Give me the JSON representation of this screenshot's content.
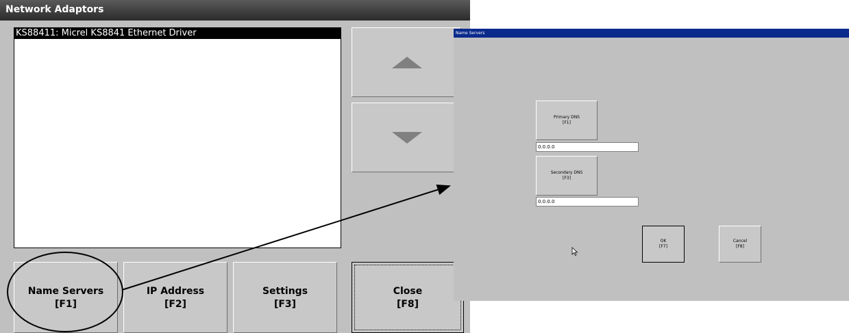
{
  "network_adaptors": {
    "title": "Network Adaptors",
    "list": [
      "KS88411: Micrel KS8841 Ethernet Driver"
    ],
    "buttons": [
      {
        "label": "Name Servers",
        "key": "[F1]"
      },
      {
        "label": "IP Address",
        "key": "[F2]"
      },
      {
        "label": "Settings",
        "key": "[F3]"
      },
      {
        "label": "Close",
        "key": "[F8]"
      }
    ],
    "scroll_up_icon": "triangle-up",
    "scroll_down_icon": "triangle-down"
  },
  "name_servers": {
    "title": "Name Servers",
    "primary": {
      "label": "Primary DNS",
      "key": "[F1]",
      "value": "0.0.0.0"
    },
    "secondary": {
      "label": "Secondary DNS",
      "key": "[F3]",
      "value": "0.0.0.0"
    },
    "ok": {
      "label": "OK",
      "key": "[F7]"
    },
    "cancel": {
      "label": "Cancel",
      "key": "[F8]"
    }
  },
  "colors": {
    "window_bg": "#c0c0c0",
    "title_dark": "#2b2b2b",
    "title_blue": "#0a2a8c",
    "selection": "#000000"
  }
}
